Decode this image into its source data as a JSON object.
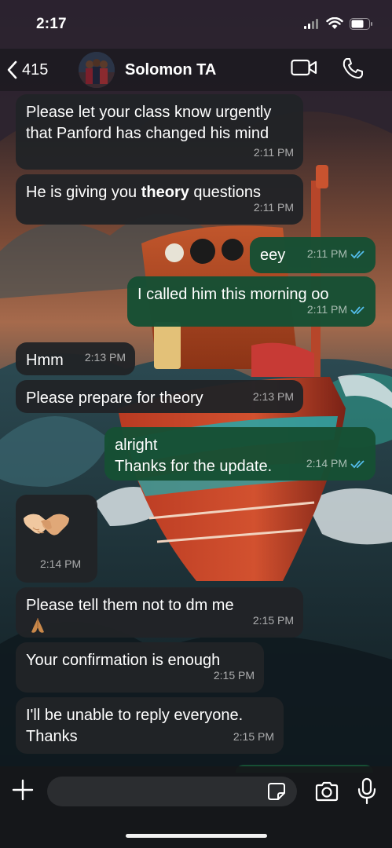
{
  "status_bar": {
    "time": "2:17",
    "icons": [
      "cellular-signal-icon",
      "wifi-icon",
      "battery-icon"
    ]
  },
  "header": {
    "back_count": "415",
    "contact_name": "Solomon TA",
    "actions": [
      "video-call-icon",
      "phone-call-icon"
    ]
  },
  "messages": [
    {
      "id": "m1",
      "direction": "incoming",
      "text": "Please let your class know urgently\nthat Panford has changed his mind",
      "time": "2:11 PM"
    },
    {
      "id": "m2",
      "direction": "incoming",
      "text_before": "He is giving you ",
      "text_bold": "theory",
      "text_after": " questions",
      "time": "2:11 PM"
    },
    {
      "id": "m3",
      "direction": "outgoing",
      "text": "eey",
      "time": "2:11 PM",
      "status": "read"
    },
    {
      "id": "m4",
      "direction": "outgoing",
      "text": "I called him this morning oo",
      "time": "2:11 PM",
      "status": "read"
    },
    {
      "id": "m5",
      "direction": "incoming",
      "text": "Hmm",
      "time": "2:13 PM"
    },
    {
      "id": "m6",
      "direction": "incoming",
      "text": "Please prepare for theory",
      "time": "2:13 PM"
    },
    {
      "id": "m7",
      "direction": "outgoing",
      "text": "alright\nThanks for the update.",
      "time": "2:14 PM",
      "status": "read"
    },
    {
      "id": "m8",
      "direction": "incoming",
      "emoji": "handshake-emoji",
      "time": "2:14 PM"
    },
    {
      "id": "m9",
      "direction": "incoming",
      "text": "Please tell them not to dm me",
      "emoji": "folded-hands-emoji",
      "time": "2:15 PM"
    },
    {
      "id": "m10",
      "direction": "incoming",
      "text": "Your confirmation is enough",
      "time": "2:15 PM"
    },
    {
      "id": "m11",
      "direction": "incoming",
      "text": "I'll be unable to reply everyone.\nThanks",
      "time": "2:15 PM"
    }
  ],
  "input_bar": {
    "placeholder": "",
    "value": "",
    "buttons": [
      "plus-icon",
      "sticker-icon",
      "camera-icon",
      "microphone-icon"
    ]
  },
  "colors": {
    "incoming_bubble": "#212326",
    "outgoing_bubble": "#164f34",
    "read_ticks": "#53bdeb"
  }
}
